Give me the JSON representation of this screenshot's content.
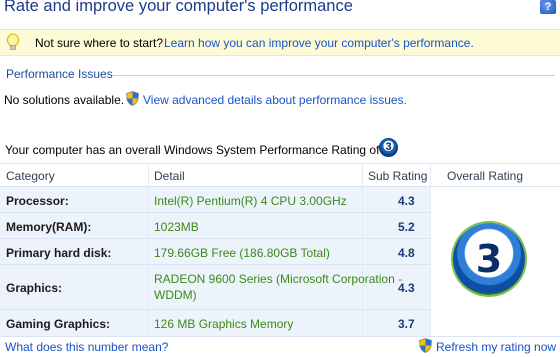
{
  "header": {
    "title": "Rate and improve your computer's performance",
    "help_label": "?"
  },
  "tip": {
    "icon": "lightbulb-icon",
    "lead": "Not sure where to start?",
    "link": "Learn how you can improve your computer's performance."
  },
  "issues": {
    "heading": "Performance Issues",
    "no_solutions": "No solutions available.",
    "shield_icon": "uac-shield-icon",
    "advanced_link": "View advanced details about performance issues."
  },
  "rating": {
    "summary": "Your computer has an overall Windows System Performance Rating of",
    "value": "3"
  },
  "table": {
    "headers": {
      "category": "Category",
      "detail": "Detail",
      "sub_rating": "Sub Rating",
      "overall_rating": "Overall Rating"
    },
    "rows": [
      {
        "category": "Processor:",
        "detail": "Intel(R) Pentium(R) 4 CPU 3.00GHz",
        "sub_rating": "4.3"
      },
      {
        "category": "Memory(RAM):",
        "detail": "1023MB",
        "sub_rating": "5.2"
      },
      {
        "category": "Primary hard disk:",
        "detail": "179.66GB Free (186.80GB Total)",
        "sub_rating": "4.8"
      },
      {
        "category": "Graphics:",
        "detail_line1": "RADEON 9600 Series (Microsoft Corporation -",
        "detail_line2": "WDDM)",
        "sub_rating": "4.3"
      },
      {
        "category": "Gaming Graphics:",
        "detail": "126 MB Graphics Memory",
        "sub_rating": "3.7"
      }
    ],
    "overall": "3"
  },
  "footer": {
    "what_link": "What does this number mean?",
    "refresh_link": "Refresh my rating now"
  },
  "colors": {
    "title": "#1e3a8a",
    "link": "#1a52c7",
    "detail_green": "#3a8a18",
    "tip_background": "#fdfbd6",
    "table_background": "#edf3fa"
  }
}
